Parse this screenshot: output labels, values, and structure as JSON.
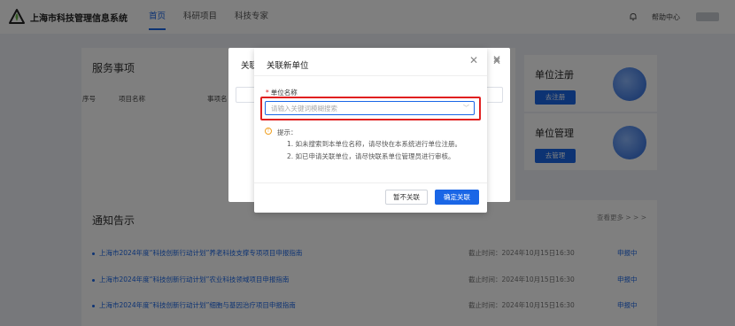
{
  "header": {
    "brand": "上海市科技管理信息系统",
    "nav": [
      {
        "label": "首页",
        "active": true
      },
      {
        "label": "科研项目",
        "active": false
      },
      {
        "label": "科技专家",
        "active": false
      }
    ],
    "help": "帮助中心",
    "bell_icon": "bell-icon",
    "logo_icon": "seedling-logo-icon"
  },
  "services": {
    "title": "服务事项",
    "columns": [
      "序号",
      "项目名称",
      "事项名"
    ]
  },
  "side_cards": [
    {
      "title": "单位注册",
      "button": "去注册"
    },
    {
      "title": "单位管理",
      "button": "去管理"
    }
  ],
  "notices": {
    "title": "通知告示",
    "more": "查看更多 > > >",
    "rows": [
      {
        "title": "上海市2024年度“科技创新行动计划”养老科技支撑专项项目申报指南",
        "deadline": "截止时间：2024年10月15日16:30",
        "status": "申报中"
      },
      {
        "title": "上海市2024年度“科技创新行动计划”农业科技领域项目申报指南",
        "deadline": "截止时间：2024年10月15日16:30",
        "status": "申报中"
      },
      {
        "title": "上海市2024年度“科技创新行动计划”细胞与基因治疗项目申报指南",
        "deadline": "截止时间：2024年10月15日16:30",
        "status": "申报中"
      }
    ]
  },
  "under_dialog": {
    "title": "关联"
  },
  "dialog": {
    "title": "关联新单位",
    "field_label": "单位名称",
    "placeholder": "请输入关键词模糊搜索",
    "tip_head": "提示：",
    "tips": [
      "1. 如未搜索到本单位名称，请尽快在本系统进行单位注册。",
      "2. 如已申请关联单位，请尽快联系单位管理员进行审核。"
    ],
    "cancel": "暂不关联",
    "confirm": "确定关联"
  },
  "colors": {
    "accent": "#1a66e6",
    "highlight": "#e02020",
    "warning": "#f0a020"
  }
}
